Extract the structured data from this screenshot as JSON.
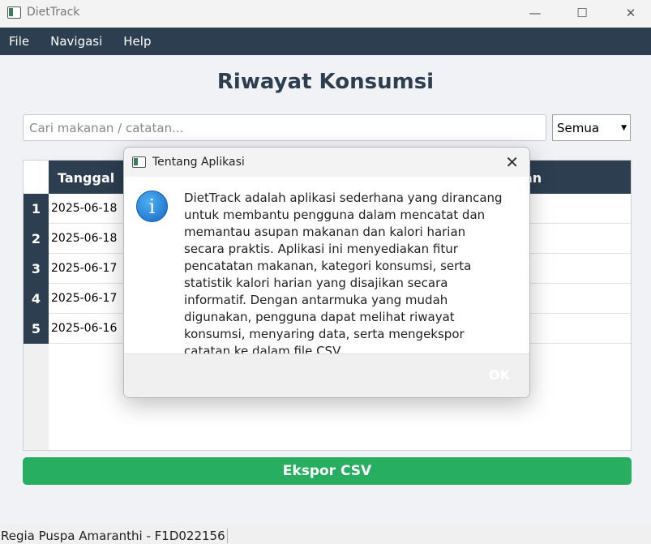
{
  "window": {
    "title": "DietTrack",
    "controls": {
      "minimize": "—",
      "maximize": "☐",
      "close": "✕"
    }
  },
  "menubar": {
    "items": [
      "File",
      "Navigasi",
      "Help"
    ]
  },
  "page": {
    "heading": "Riwayat Konsumsi",
    "search_placeholder": "Cari makanan / catatan...",
    "filter_value": "Semua",
    "export_label": "Ekspor CSV"
  },
  "table": {
    "headers": [
      "Tanggal",
      "an"
    ],
    "row_numbers": [
      "1",
      "2",
      "3",
      "4",
      "5"
    ],
    "dates": [
      "2025-06-18",
      "2025-06-18",
      "2025-06-17",
      "2025-06-17",
      "2025-06-16"
    ]
  },
  "status": "Regia Puspa Amaranthi - F1D022156",
  "dialog": {
    "title": "Tentang Aplikasi",
    "icon": "info-icon",
    "icon_glyph": "i",
    "message": "DietTrack adalah aplikasi sederhana yang dirancang untuk membantu pengguna dalam mencatat dan memantau asupan makanan dan kalori harian secara praktis. Aplikasi ini menyediakan fitur pencatatan makanan, kategori konsumsi, serta statistik kalori harian yang disajikan secara informatif. Dengan antarmuka yang mudah digunakan, pengguna dapat melihat riwayat konsumsi, menyaring data, serta mengekspor catatan ke dalam file CSV.",
    "ok_label": "OK"
  },
  "colors": {
    "header_bg": "#2c3e50",
    "accent_green": "#27ae60",
    "info_blue": "#1466c6"
  }
}
